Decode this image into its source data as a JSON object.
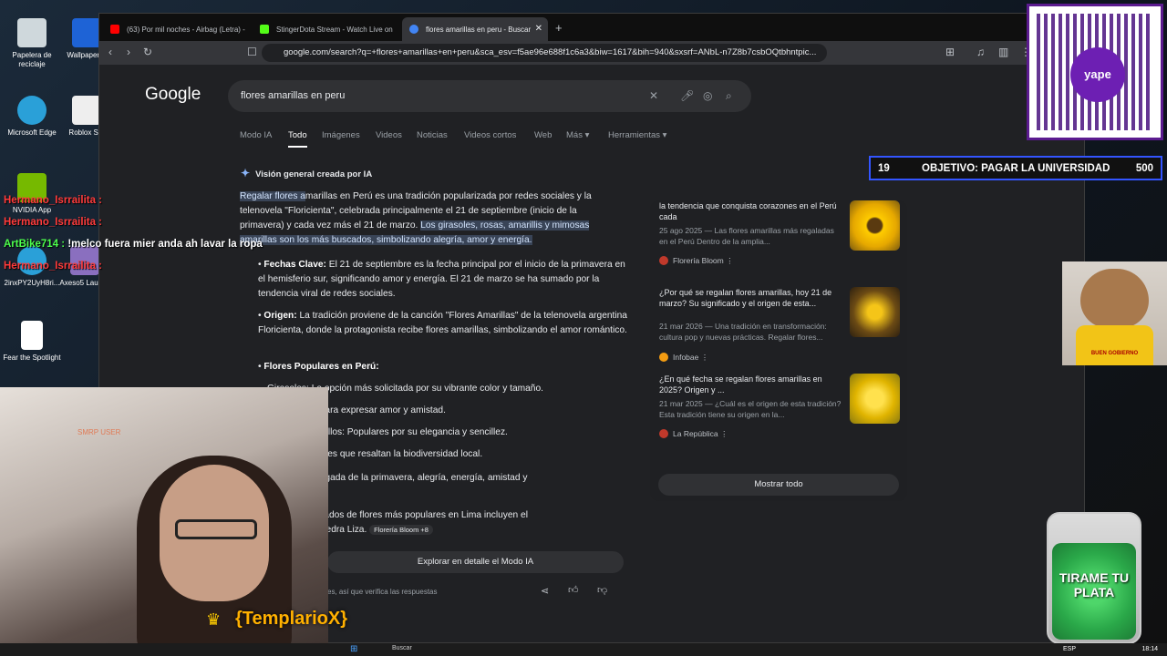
{
  "desktop": {
    "icons": [
      {
        "label": "Papelera de reciclaje",
        "icon": "recycle-bin-icon"
      },
      {
        "label": "Wallpaper E",
        "icon": "wallpaper-icon"
      },
      {
        "label": "Microsoft Edge",
        "icon": "edge-icon"
      },
      {
        "label": "Roblox Stu",
        "icon": "roblox-icon"
      },
      {
        "label": "NVIDIA App",
        "icon": "nvidia-icon"
      },
      {
        "label": "2inxPY2UyH8ri...",
        "icon": "edge-icon"
      },
      {
        "label": "Axeso5 Launch",
        "icon": "launcher-icon"
      },
      {
        "label": "Fear the Spotlight",
        "icon": "file-icon"
      }
    ]
  },
  "browser": {
    "tabs": [
      {
        "label": "(63) Por mil noches - Airbag (Letra) -",
        "color": "#ff0000"
      },
      {
        "label": "StingerDota Stream - Watch Live on",
        "color": "#53fc18"
      },
      {
        "label": "flores amarillas en peru - Buscar",
        "color": "#4285f4"
      }
    ],
    "new_tab": "+",
    "url": "google.com/search?q=+flores+amarillas+en+peru&sca_esv=f5ae96e688f1c6a3&biw=1617&bih=940&sxsrf=ANbL-n7Z8b7csbOQtbhntpic..."
  },
  "google": {
    "logo": "Google",
    "query": "flores amarillas en peru",
    "tabs": [
      "Modo IA",
      "Todo",
      "Imágenes",
      "Videos",
      "Noticias",
      "Videos cortos",
      "Web",
      "Más ▾",
      "Herramientas ▾"
    ],
    "ai_overview": {
      "heading": "Visión general creada por IA",
      "intro_hl1": "Regalar flores a",
      "intro_rest": "marillas en Perú es una tradición popularizada por redes sociales y la telenovela \"Floricienta\", celebrada principalmente el 21 de septiembre (inicio de la primavera) y cada vez más el 21 de marzo.",
      "intro_hl2": "Los girasoles, rosas, amarillis y mimosas amarillas son los más buscados, simbolizando alegría, amor y energía.",
      "bullets": [
        {
          "title": "Fechas Clave:",
          "text": " El 21 de septiembre es la fecha principal por el inicio de la primavera en el hemisferio sur, significando amor y energía. El 21 de marzo se ha sumado por la tendencia viral de redes sociales."
        },
        {
          "title": "Origen:",
          "text": " La tradición proviene de la canción \"Flores Amarillas\" de la telenovela argentina Floricienta, donde la protagonista recibe flores amarillas, simbolizando el amor romántico."
        },
        {
          "title": "Flores Populares en Perú:",
          "text": ""
        }
      ],
      "sub_items": [
        "Girasoles: La opción más solicitada por su vibrante color y tamaño.",
        "as: Clásicas para expresar amor y amistad.",
        "ulipanes Amarillos: Populares por su elegancia y sencillez.",
        "lashua: Especies que resaltan la biodiversidad local.",
        "resentan la llegada de la primavera, alegría, energía, amistad y",
        "pra: Los mercados de flores más populares en Lima incluyen el",
        "s de Acho y Piedra Liza."
      ],
      "source_chip": "Florería Bloom +8",
      "more_button": "Explorar en detalle el Modo IA",
      "feedback": "es, así que verifica las respuestas"
    },
    "sources": [
      {
        "title": "la tendencia que conquista corazones en el Perú cada",
        "snippet": "25 ago 2025 — Las flores amarillas más regaladas en el Perú Dentro de la amplia...",
        "site": "Florería Bloom",
        "color": "#c0392b"
      },
      {
        "title": "¿Por qué se regalan flores amarillas, hoy 21 de marzo? Su significado y el origen de esta...",
        "snippet": "21 mar 2026 — Una tradición en transformación: cultura pop y nuevas prácticas. Regalar flores...",
        "site": "Infobae",
        "color": "#f39c12"
      },
      {
        "title": "¿En qué fecha se regalan flores amarillas en 2025? Origen y ...",
        "snippet": "21 mar 2025 — ¿Cuál es el origen de esta tradición? Esta tradición tiene su origen en la...",
        "site": "La República",
        "color": "#c0392b"
      }
    ],
    "show_all": "Mostrar todo"
  },
  "stream": {
    "chat": [
      {
        "user": "Hermano_Isrrailita :",
        "msg": "",
        "color": "#ff3b3b"
      },
      {
        "user": "Hermano_Isrrailita :",
        "msg": "",
        "color": "#ff3b3b"
      },
      {
        "user": "ArtBike714 :",
        "msg": " !melco fuera mier anda ah lavar la ropa",
        "color": "#4dff4d"
      },
      {
        "user": "Hermano_Isrrailita :",
        "msg": "",
        "color": "#ff3b3b"
      }
    ],
    "cam_label": "SMRP USER",
    "streamer_name": "{TemplarioX}",
    "goal": {
      "current": "19",
      "text": "OBJETIVO: PAGAR LA UNIVERSIDAD",
      "target": "500"
    },
    "yape": "yape",
    "dog_shirt": "BUEN GOBIERNO",
    "jar_text": "TIRAME TU PLATA"
  },
  "taskbar": {
    "search": "Buscar",
    "lang": "ESP",
    "time": "18:14"
  }
}
